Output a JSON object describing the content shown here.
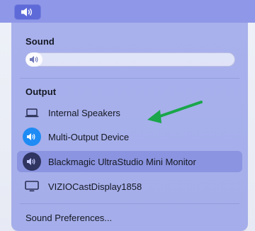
{
  "menubar": {
    "icon": "speaker-icon"
  },
  "sound": {
    "title": "Sound",
    "volume_level": 0.08
  },
  "output": {
    "title": "Output",
    "devices": [
      {
        "label": "Internal Speakers",
        "icon": "laptop-icon",
        "style": "plain"
      },
      {
        "label": "Multi-Output Device",
        "icon": "speaker-icon",
        "style": "selected"
      },
      {
        "label": "Blackmagic UltraStudio Mini Monitor",
        "icon": "speaker-icon",
        "style": "dark"
      },
      {
        "label": "VIZIOCastDisplay1858",
        "icon": "monitor-icon",
        "style": "plain"
      }
    ]
  },
  "footer": {
    "preferences_label": "Sound Preferences..."
  },
  "colors": {
    "accent_blue": "#1f8bf4",
    "annotation_arrow": "#1aa64a"
  }
}
